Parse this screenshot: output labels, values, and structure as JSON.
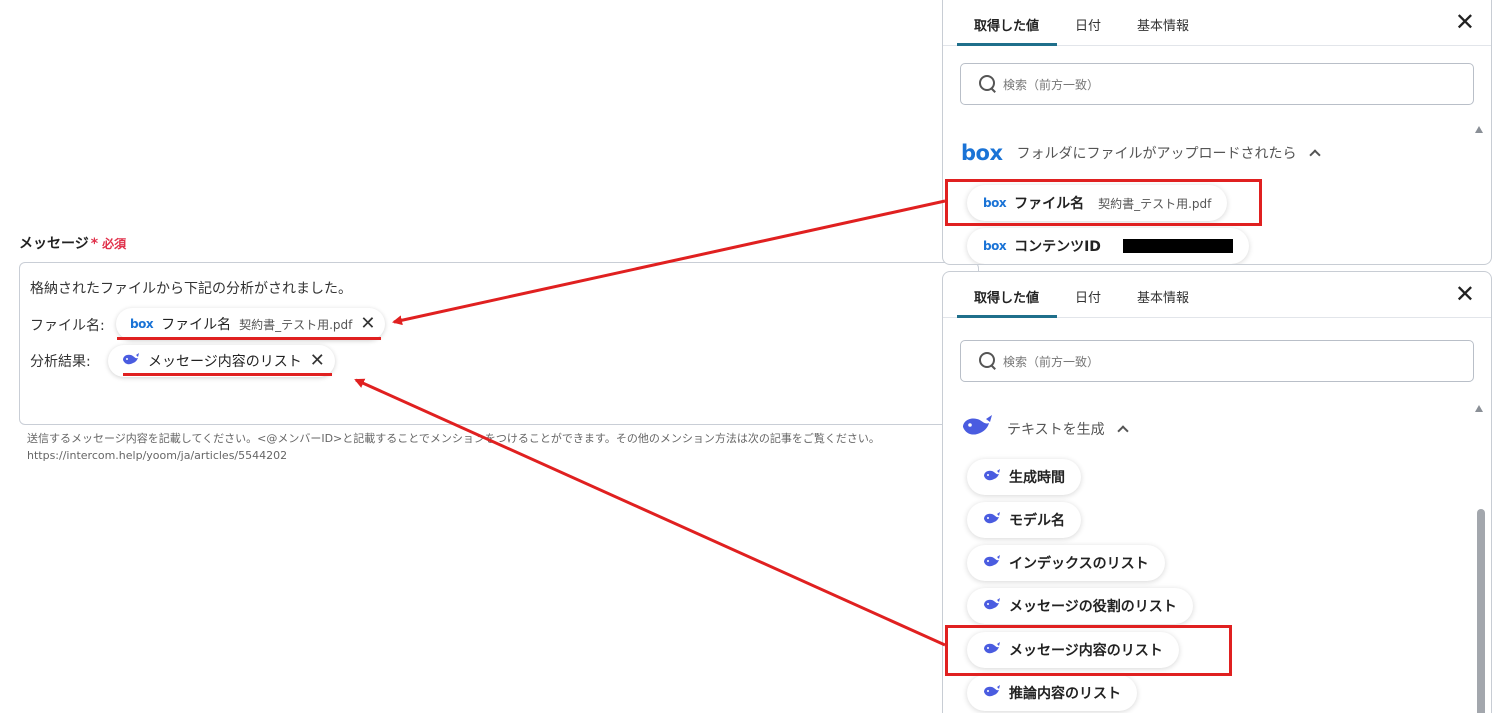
{
  "form": {
    "label": "メッセージ",
    "required_star": "*",
    "required": "必須",
    "line1": "格納されたファイルから下記の分析がされました。",
    "line2_label": "ファイル名:",
    "line3_label": "分析結果:",
    "chip_file": {
      "icon": "box-icon",
      "label": "ファイル名",
      "value": "契約書_テスト用.pdf",
      "remove": "✕"
    },
    "chip_result": {
      "icon": "whale-icon",
      "label": "メッセージ内容のリスト",
      "remove": "✕"
    },
    "help_line1": "送信するメッセージ内容を記載してください。<@メンバーID>と記載することでメンションをつけることができます。その他のメンション方法は次の記事をご覧ください。",
    "help_line2": "https://intercom.help/yoom/ja/articles/5544202"
  },
  "panel_top": {
    "tabs": [
      "取得した値",
      "日付",
      "基本情報"
    ],
    "close": "✕",
    "search_placeholder": "検索（前方一致）",
    "section_logo": "box",
    "section_title": "フォルダにファイルがアップロードされたら",
    "items": [
      {
        "logo": "box",
        "label": "ファイル名",
        "value": "契約書_テスト用.pdf"
      },
      {
        "logo": "box",
        "label": "コンテンツID"
      }
    ]
  },
  "panel_bottom": {
    "tabs": [
      "取得した値",
      "日付",
      "基本情報"
    ],
    "close": "✕",
    "search_placeholder": "検索（前方一致）",
    "section_title": "テキストを生成",
    "items": [
      {
        "label": "生成時間"
      },
      {
        "label": "モデル名"
      },
      {
        "label": "インデックスのリスト"
      },
      {
        "label": "メッセージの役割のリスト"
      },
      {
        "label": "メッセージ内容のリスト"
      },
      {
        "label": "推論内容のリスト"
      }
    ]
  },
  "colors": {
    "highlight": "#e02020",
    "box_blue": "#1a73d6",
    "whale_blue": "#4a5ce0",
    "tab_indicator": "#1f6f8b",
    "required": "#e0304a"
  }
}
